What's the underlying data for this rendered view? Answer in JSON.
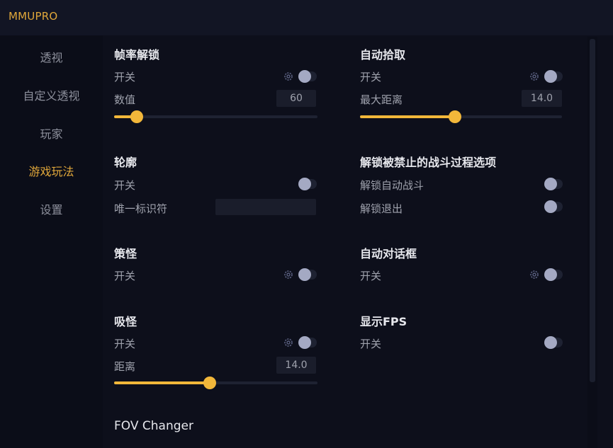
{
  "app": {
    "title": "MMUPRO"
  },
  "sidebar": {
    "items": [
      {
        "label": "透视",
        "active": false
      },
      {
        "label": "自定义透视",
        "active": false
      },
      {
        "label": "玩家",
        "active": false
      },
      {
        "label": "游戏玩法",
        "active": true
      },
      {
        "label": "设置",
        "active": false
      }
    ]
  },
  "colors": {
    "accent": "#f2b73a",
    "accent_text": "#e0a73a",
    "toggle_knob": "#a4a9c3"
  },
  "sections": {
    "fps_unlock": {
      "title": "帧率解锁",
      "toggle_label": "开关",
      "toggle_on": false,
      "value_label": "数值",
      "value": "60",
      "slider_fraction": 0.11
    },
    "outline": {
      "title": "轮廓",
      "toggle_label": "开关",
      "toggle_on": false,
      "uid_label": "唯一标识符",
      "uid_value": ""
    },
    "mob_vacuum": {
      "title": "策怪",
      "toggle_label": "开关",
      "toggle_on": false
    },
    "mob_attract": {
      "title": "吸怪",
      "toggle_label": "开关",
      "toggle_on": false,
      "distance_label": "距离",
      "distance_value": "14.0",
      "slider_fraction": 0.47
    },
    "fov_changer": {
      "title": "FOV Changer"
    },
    "auto_pickup": {
      "title": "自动拾取",
      "toggle_label": "开关",
      "toggle_on": false,
      "max_distance_label": "最大距离",
      "max_distance_value": "14.0",
      "slider_fraction": 0.47
    },
    "unlock_forbidden": {
      "title": "解锁被禁止的战斗过程选项",
      "auto_battle_label": "解锁自动战斗",
      "auto_battle_on": false,
      "exit_label": "解锁退出",
      "exit_on": false
    },
    "auto_dialog": {
      "title": "自动对话框",
      "toggle_label": "开关",
      "toggle_on": false
    },
    "show_fps": {
      "title": "显示FPS",
      "toggle_label": "开关",
      "toggle_on": false
    }
  }
}
